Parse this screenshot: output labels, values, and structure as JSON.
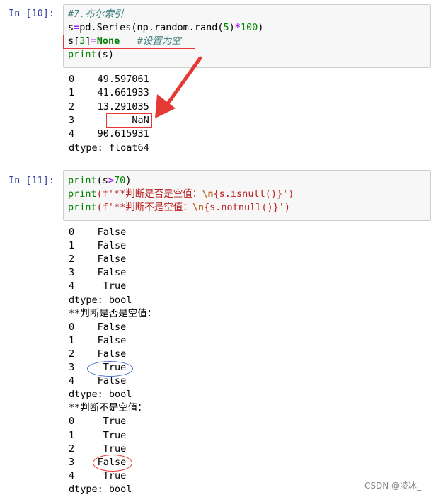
{
  "cell10": {
    "prompt": "In  [10]:",
    "lines": [
      [
        {
          "t": "#7.布尔索引",
          "c": "cm-comment"
        }
      ],
      [
        {
          "t": "s",
          "c": ""
        },
        {
          "t": "=",
          "c": "cm-op"
        },
        {
          "t": "pd.Series(np.random.rand(",
          "c": ""
        },
        {
          "t": "5",
          "c": "cm-num"
        },
        {
          "t": ")",
          "c": ""
        },
        {
          "t": "*",
          "c": "cm-op"
        },
        {
          "t": "100",
          "c": "cm-num"
        },
        {
          "t": ")",
          "c": ""
        }
      ],
      [
        {
          "t": "s[",
          "c": ""
        },
        {
          "t": "3",
          "c": "cm-num"
        },
        {
          "t": "]",
          "c": ""
        },
        {
          "t": "=",
          "c": "cm-op"
        },
        {
          "t": "None",
          "c": "cm-kw"
        },
        {
          "t": "   ",
          "c": ""
        },
        {
          "t": "#设置为空",
          "c": "cm-comment"
        }
      ],
      [
        {
          "t": "print",
          "c": "cm-builtin"
        },
        {
          "t": "(s)",
          "c": ""
        }
      ]
    ],
    "output": [
      "0    49.597061",
      "1    41.661933",
      "2    13.291035",
      "3          NaN",
      "4    90.615931",
      "dtype: float64"
    ]
  },
  "cell11": {
    "prompt": "In  [11]:",
    "lines": [
      [
        {
          "t": "print",
          "c": "cm-builtin"
        },
        {
          "t": "(s",
          "c": ""
        },
        {
          "t": ">",
          "c": "cm-op"
        },
        {
          "t": "70",
          "c": "cm-num"
        },
        {
          "t": ")",
          "c": ""
        }
      ],
      [
        {
          "t": "print",
          "c": "cm-builtin"
        },
        {
          "t": "(f'**判断是否是空值：",
          "c": "cm-str"
        },
        {
          "t": "\\n",
          "c": "cm-esc"
        },
        {
          "t": "{s.isnull()}')",
          "c": "cm-str"
        }
      ],
      [
        {
          "t": "print",
          "c": "cm-builtin"
        },
        {
          "t": "(f'**判断不是空值：",
          "c": "cm-str"
        },
        {
          "t": "\\n",
          "c": "cm-esc"
        },
        {
          "t": "{s.notnull()}')",
          "c": "cm-str"
        }
      ]
    ],
    "output": [
      "0    False",
      "1    False",
      "2    False",
      "3    False",
      "4     True",
      "dtype: bool",
      "**判断是否是空值：",
      "0    False",
      "1    False",
      "2    False",
      "3     True",
      "4    False",
      "dtype: bool",
      "**判断不是空值：",
      "0     True",
      "1     True",
      "2     True",
      "3    False",
      "4     True",
      "dtype: bool"
    ]
  },
  "watermark": "CSDN @凌冰_",
  "colors": {
    "annotation_red": "#e53935",
    "annotation_blue": "#4a6fd0",
    "prompt_blue": "#303f9f"
  }
}
